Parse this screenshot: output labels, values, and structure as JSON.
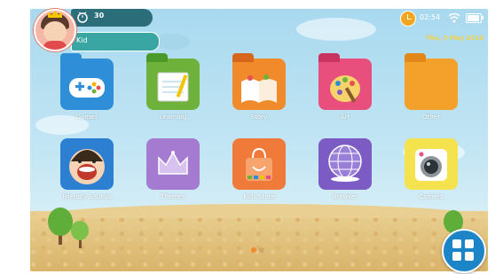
{
  "status": {
    "timer_value": "30",
    "child_name": "Kid",
    "time": "02:54",
    "date": "Thu, 5 May 2016",
    "icons": [
      "timer-icon",
      "clock-icon",
      "wifi-icon",
      "battery-icon"
    ],
    "battery_level": 0.9
  },
  "apps": [
    {
      "name": "games-app",
      "label": "Games",
      "icon": "gamepad-folder-icon",
      "color": "#2e8fd8",
      "tab": "#2e8fd8"
    },
    {
      "name": "learning-app",
      "label": "Learning",
      "icon": "notebook-folder-icon",
      "color": "#6fb23b",
      "tab": "#4a9a2a"
    },
    {
      "name": "story-app",
      "label": "Story",
      "icon": "storybook-folder-icon",
      "color": "#f08a2a",
      "tab": "#d7661c"
    },
    {
      "name": "art-app",
      "label": "Art",
      "icon": "palette-folder-icon",
      "color": "#e94f7d",
      "tab": "#c8335f"
    },
    {
      "name": "other-app",
      "label": "Other",
      "icon": "folder-icon",
      "color": "#f4a12b",
      "tab": "#e18619"
    },
    {
      "name": "friendly-sounds-app",
      "label": "Friendly Sounds",
      "icon": "smiling-face-icon",
      "color": "#2d7fd1"
    },
    {
      "name": "themes-app",
      "label": "Themes",
      "icon": "crown-icon",
      "color": "#a57bd1"
    },
    {
      "name": "kids-store-app",
      "label": "Kids Store",
      "icon": "shopping-bag-icon",
      "color": "#f07a3a"
    },
    {
      "name": "browser-app",
      "label": "Browser",
      "icon": "globe-icon",
      "color": "#7d5bc4"
    },
    {
      "name": "camera-app",
      "label": "Camera",
      "icon": "camera-icon",
      "color": "#f4e34f"
    }
  ],
  "page_indicator": {
    "pages": 2,
    "current": 1
  },
  "colors": {
    "accent": "#1b85c8",
    "status_teal": "#2b6e7a",
    "name_teal": "#3aa6a3",
    "date_yellow": "#f3d24a"
  },
  "bottom_button_icon": "app-grid-icon"
}
